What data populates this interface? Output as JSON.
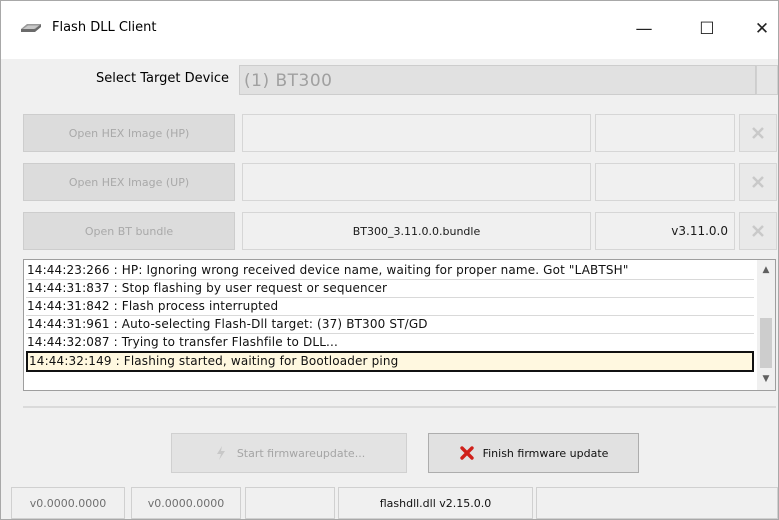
{
  "window": {
    "title": "Flash DLL Client",
    "controls": {
      "minimize": "—",
      "maximize": "☐",
      "close": "✕"
    }
  },
  "device": {
    "label": "Select Target Device",
    "value": "(1) BT300"
  },
  "rows": [
    {
      "button": "Open HEX Image (HP)",
      "file": "",
      "version": ""
    },
    {
      "button": "Open HEX Image (UP)",
      "file": "",
      "version": ""
    },
    {
      "button": "Open BT bundle",
      "file": "BT300_3.11.0.0.bundle",
      "version": "v3.11.0.0"
    }
  ],
  "log": {
    "lines": [
      "14:44:23:266 : HP: Ignoring wrong received device name, waiting for proper name. Got \"LABTSH\"",
      "14:44:31:837 : Stop flashing by user request or sequencer",
      "14:44:31:842 : Flash process interrupted",
      "14:44:31:961 : Auto-selecting Flash-Dll target: (37) BT300 ST/GD",
      "14:44:32:087 : Trying to transfer Flashfile to DLL...",
      "14:44:32:149 : Flashing started, waiting for Bootloader ping"
    ],
    "selected_index": 5
  },
  "actions": {
    "start": "Start firmwareupdate...",
    "finish": "Finish firmware update"
  },
  "status": {
    "cells": [
      "v0.0000.0000",
      "v0.0000.0000",
      "",
      "flashdll.dll v2.15.0.0",
      ""
    ]
  },
  "colors": {
    "finish_icon": "#d0201a",
    "selected_log_bg": "#fff8e0"
  },
  "icons": [
    "app-icon",
    "clear-icon",
    "red-x-icon",
    "flash-icon",
    "scroll-up-icon",
    "scroll-down-icon"
  ]
}
